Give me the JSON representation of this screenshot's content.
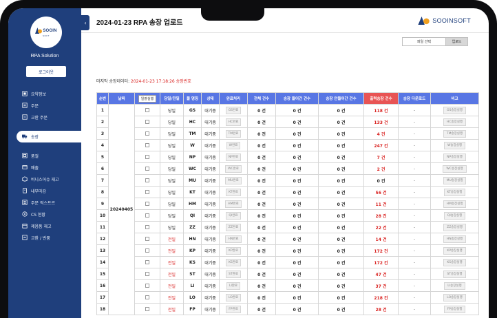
{
  "app": {
    "title": "2024-01-23 RPA 송장 업로드",
    "name": "RPA Solution",
    "logout_label": "로그아웃",
    "logo_text": "SOOIN",
    "logo_sub": "SOFT",
    "brand_text": "SOOINSOFT",
    "brand_color": "#1f3f7c",
    "sidebar_toggle_icon": "‹"
  },
  "sidebar": {
    "items": [
      {
        "label": "요약정보",
        "icon": "summary-icon"
      },
      {
        "label": "주문",
        "icon": "order-icon"
      },
      {
        "label": "교환 주문",
        "icon": "exchange-order-icon"
      },
      {
        "label": "송장",
        "icon": "truck-icon",
        "active": true
      },
      {
        "label": "품절",
        "icon": "soldout-icon"
      },
      {
        "label": "매출",
        "icon": "sales-icon"
      },
      {
        "label": "비니스어슈 재고",
        "icon": "stock-icon"
      },
      {
        "label": "내부마감",
        "icon": "closing-icon"
      },
      {
        "label": "주문 적스트르",
        "icon": "order-list-icon"
      },
      {
        "label": "CS 현황",
        "icon": "cs-icon"
      },
      {
        "label": "제음품 재고",
        "icon": "product-stock-icon"
      },
      {
        "label": "교환 / 반품",
        "icon": "return-icon"
      }
    ]
  },
  "controls": {
    "file_select_label": "파일 선택",
    "upload_label": "업로드"
  },
  "last_update": {
    "prefix": "마지막 송장데이터: ",
    "value": "2024-01-23 17:18:26 송장번호"
  },
  "table": {
    "headers": [
      "순번",
      "날짜",
      "일괄실행",
      "당일/전일",
      "몰 명칭",
      "상태",
      "완료처리",
      "전체 건수",
      "송장 들어간 건수",
      "송장 안들어간 건수",
      "출력송장 건수",
      "송장 다운로드",
      "비고"
    ],
    "batch_button_label": "일괄실행",
    "date": "20240405",
    "rows": [
      {
        "no": "1",
        "day": "당일",
        "mall": "GS",
        "status": "대기중",
        "done": "GS완료",
        "total": "0 건",
        "in": "0 건",
        "out": "0 건",
        "print": "118 건",
        "print_red": true,
        "dl": "-",
        "note": "GS송장실행"
      },
      {
        "no": "2",
        "day": "당일",
        "mall": "HC",
        "status": "대기중",
        "done": "HC완료",
        "total": "0 건",
        "in": "0 건",
        "out": "0 건",
        "print": "133 건",
        "print_red": true,
        "dl": "-",
        "note": "HC송장실행"
      },
      {
        "no": "3",
        "day": "당일",
        "mall": "TM",
        "status": "대기중",
        "done": "TM완료",
        "total": "0 건",
        "in": "0 건",
        "out": "0 건",
        "print": "4 건",
        "print_red": true,
        "dl": "-",
        "note": "TM송장실행"
      },
      {
        "no": "4",
        "day": "당일",
        "mall": "W",
        "status": "대기중",
        "done": "W완료",
        "total": "0 건",
        "in": "0 건",
        "out": "0 건",
        "print": "247 건",
        "print_red": true,
        "dl": "-",
        "note": "W송장실행"
      },
      {
        "no": "5",
        "day": "당일",
        "mall": "NP",
        "status": "대기중",
        "done": "NP완료",
        "total": "0 건",
        "in": "0 건",
        "out": "0 건",
        "print": "7 건",
        "print_red": true,
        "dl": "-",
        "note": "NP송장실행"
      },
      {
        "no": "6",
        "day": "당일",
        "mall": "WC",
        "status": "대기중",
        "done": "WC완료",
        "total": "0 건",
        "in": "0 건",
        "out": "0 건",
        "print": "2 건",
        "print_red": true,
        "dl": "-",
        "note": "WC송장실행"
      },
      {
        "no": "7",
        "day": "당일",
        "mall": "MU",
        "status": "대기중",
        "done": "MU완료",
        "total": "0 건",
        "in": "0 건",
        "out": "0 건",
        "print": "0 건",
        "print_red": false,
        "dl": "-",
        "note": "MU송장실행"
      },
      {
        "no": "8",
        "day": "당일",
        "mall": "KT",
        "status": "대기중",
        "done": "KT완료",
        "total": "0 건",
        "in": "0 건",
        "out": "0 건",
        "print": "56 건",
        "print_red": true,
        "dl": "-",
        "note": "KT송장실행"
      },
      {
        "no": "9",
        "day": "당일",
        "mall": "HM",
        "status": "대기중",
        "done": "HM완료",
        "total": "0 건",
        "in": "0 건",
        "out": "0 건",
        "print": "11 건",
        "print_red": true,
        "dl": "-",
        "note": "HM송장실행"
      },
      {
        "no": "10",
        "day": "당일",
        "mall": "QI",
        "status": "대기중",
        "done": "QI완료",
        "total": "0 건",
        "in": "0 건",
        "out": "0 건",
        "print": "28 건",
        "print_red": true,
        "dl": "-",
        "note": "QI송장실행"
      },
      {
        "no": "11",
        "day": "당일",
        "mall": "ZZ",
        "status": "대기중",
        "done": "ZZ완료",
        "total": "0 건",
        "in": "0 건",
        "out": "0 건",
        "print": "22 건",
        "print_red": true,
        "dl": "-",
        "note": "ZZ송장실행"
      },
      {
        "no": "12",
        "day": "전일",
        "mall": "HN",
        "status": "대기중",
        "done": "HN완료",
        "total": "0 건",
        "in": "0 건",
        "out": "0 건",
        "print": "14 건",
        "print_red": true,
        "dl": "-",
        "note": "HN송장실행"
      },
      {
        "no": "13",
        "day": "전일",
        "mall": "KP",
        "status": "대기중",
        "done": "KP완료",
        "total": "0 건",
        "in": "0 건",
        "out": "0 건",
        "print": "172 건",
        "print_red": true,
        "dl": "-",
        "note": "KP송장실행"
      },
      {
        "no": "14",
        "day": "전일",
        "mall": "KS",
        "status": "대기중",
        "done": "KS완료",
        "total": "0 건",
        "in": "0 건",
        "out": "0 건",
        "print": "172 건",
        "print_red": true,
        "dl": "-",
        "note": "KS송장실행"
      },
      {
        "no": "15",
        "day": "전일",
        "mall": "ST",
        "status": "대기중",
        "done": "ST완료",
        "total": "0 건",
        "in": "0 건",
        "out": "0 건",
        "print": "47 건",
        "print_red": true,
        "dl": "-",
        "note": "ST송장실행"
      },
      {
        "no": "16",
        "day": "전일",
        "mall": "LI",
        "status": "대기중",
        "done": "LI완료",
        "total": "0 건",
        "in": "0 건",
        "out": "0 건",
        "print": "37 건",
        "print_red": true,
        "dl": "-",
        "note": "LI송장실행"
      },
      {
        "no": "17",
        "day": "전일",
        "mall": "LO",
        "status": "대기중",
        "done": "LO완료",
        "total": "0 건",
        "in": "0 건",
        "out": "0 건",
        "print": "218 건",
        "print_red": true,
        "dl": "-",
        "note": "LO송장실행"
      },
      {
        "no": "18",
        "day": "전일",
        "mall": "FP",
        "status": "대기중",
        "done": "FP완료",
        "total": "0 건",
        "in": "0 건",
        "out": "0 건",
        "print": "28 건",
        "print_red": true,
        "dl": "-",
        "note": "FP송장실행"
      }
    ]
  },
  "colors": {
    "header_blue": "#5876e4",
    "header_red": "#e85454",
    "sidebar": "#1f3f7c",
    "accent_red": "#d9211f"
  }
}
